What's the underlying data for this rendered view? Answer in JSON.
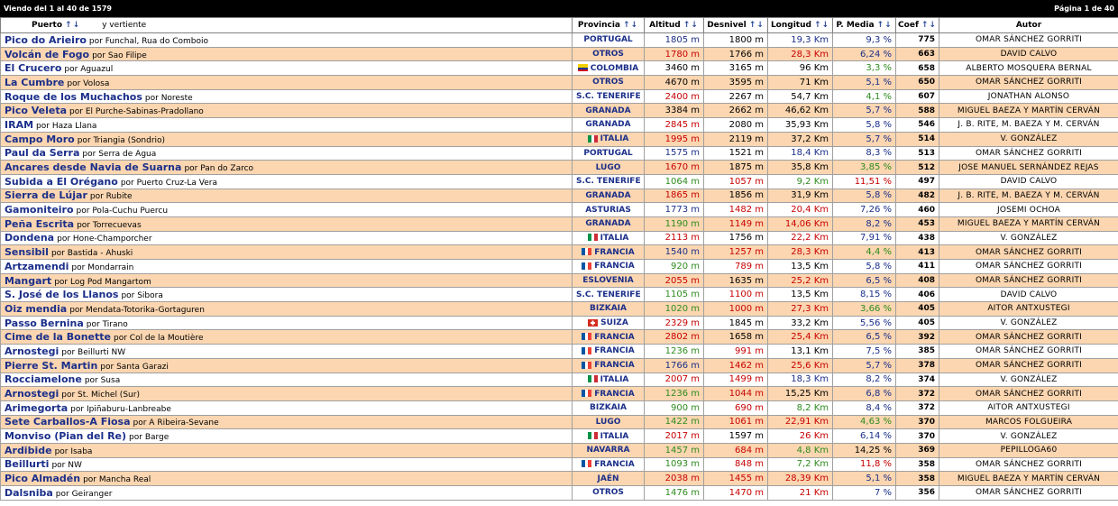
{
  "header": {
    "left": "Viendo del 1 al 40 de 1579",
    "right": "Página 1 de 40"
  },
  "columns": {
    "puerto": "Puerto",
    "vertiente": "y   vertiente",
    "provincia": "Provincia",
    "altitud": "Altitud",
    "desnivel": "Desnivel",
    "longitud": "Longitud",
    "pmedia": "P. Media",
    "coef": "Coef",
    "autor": "Autor"
  },
  "sort_arrows": "↑↓",
  "rows": [
    {
      "name": "Pico do Arieiro",
      "vert": "Funchal, Rua do Comboio",
      "prov": "PORTUGAL",
      "flag": "",
      "alt": "1805 m",
      "alt_c": "blue",
      "des": "1800 m",
      "des_c": "black",
      "lon": "19,3 Km",
      "lon_c": "blue",
      "pm": "9,3 %",
      "pm_c": "blue",
      "coef": "775",
      "autor": "OMAR SÁNCHEZ GORRITI"
    },
    {
      "name": "Volcán de Fogo",
      "vert": "Sao Filipe",
      "prov": "OTROS",
      "flag": "",
      "alt": "1780 m",
      "alt_c": "red",
      "des": "1766 m",
      "des_c": "black",
      "lon": "28,3 Km",
      "lon_c": "red",
      "pm": "6,24 %",
      "pm_c": "blue",
      "coef": "663",
      "autor": "DAVID CALVO"
    },
    {
      "name": "El Crucero",
      "vert": "Aguazul",
      "prov": "COLOMBIA",
      "flag": "colombia",
      "alt": "3460 m",
      "alt_c": "black",
      "des": "3165 m",
      "des_c": "black",
      "lon": "96 Km",
      "lon_c": "black",
      "pm": "3,3 %",
      "pm_c": "green",
      "coef": "658",
      "autor": "ALBERTO MOSQUERA BERNAL"
    },
    {
      "name": "La Cumbre",
      "vert": "Volosa",
      "prov": "OTROS",
      "flag": "",
      "alt": "4670 m",
      "alt_c": "black",
      "des": "3595 m",
      "des_c": "black",
      "lon": "71 Km",
      "lon_c": "black",
      "pm": "5,1 %",
      "pm_c": "blue",
      "coef": "650",
      "autor": "OMAR SÁNCHEZ GORRITI"
    },
    {
      "name": "Roque de los Muchachos",
      "vert": "Noreste",
      "prov": "S.C. TENERIFE",
      "flag": "",
      "alt": "2400 m",
      "alt_c": "red",
      "des": "2267 m",
      "des_c": "black",
      "lon": "54,7 Km",
      "lon_c": "black",
      "pm": "4,1 %",
      "pm_c": "green",
      "coef": "607",
      "autor": "JONATHAN ALONSO"
    },
    {
      "name": "Pico Veleta",
      "vert": "El Purche-Sabinas-Pradollano",
      "prov": "GRANADA",
      "flag": "",
      "alt": "3384 m",
      "alt_c": "black",
      "des": "2662 m",
      "des_c": "black",
      "lon": "46,62 Km",
      "lon_c": "black",
      "pm": "5,7 %",
      "pm_c": "blue",
      "coef": "588",
      "autor": "MIGUEL BAEZA Y MARTÍN CERVÁN"
    },
    {
      "name": "IRAM",
      "vert": "Haza Llana",
      "prov": "GRANADA",
      "flag": "",
      "alt": "2845 m",
      "alt_c": "red",
      "des": "2080 m",
      "des_c": "black",
      "lon": "35,93 Km",
      "lon_c": "black",
      "pm": "5,8 %",
      "pm_c": "blue",
      "coef": "546",
      "autor": "J. B. RITE, M. BAEZA Y M. CERVÁN"
    },
    {
      "name": "Campo Moro",
      "vert": "Triangia (Sondrio)",
      "prov": "ITALIA",
      "flag": "italia",
      "alt": "1995 m",
      "alt_c": "red",
      "des": "2119 m",
      "des_c": "black",
      "lon": "37,2 Km",
      "lon_c": "black",
      "pm": "5,7 %",
      "pm_c": "blue",
      "coef": "514",
      "autor": "V. GONZÁLEZ"
    },
    {
      "name": "Paul da Serra",
      "vert": "Serra de Agua",
      "prov": "PORTUGAL",
      "flag": "",
      "alt": "1575 m",
      "alt_c": "blue",
      "des": "1521 m",
      "des_c": "black",
      "lon": "18,4 Km",
      "lon_c": "blue",
      "pm": "8,3 %",
      "pm_c": "blue",
      "coef": "513",
      "autor": "OMAR SÁNCHEZ GORRITI"
    },
    {
      "name": "Ancares desde Navia de Suarna",
      "vert": "Pan do Zarco",
      "prov": "LUGO",
      "flag": "",
      "alt": "1670 m",
      "alt_c": "red",
      "des": "1875 m",
      "des_c": "black",
      "lon": "35,8 Km",
      "lon_c": "black",
      "pm": "3,85 %",
      "pm_c": "green",
      "coef": "512",
      "autor": "JOSE MANUEL SERNÁNDEZ REJAS"
    },
    {
      "name": "Subida a El Orégano",
      "vert": "Puerto Cruz-La Vera",
      "prov": "S.C. TENERIFE",
      "flag": "",
      "alt": "1064 m",
      "alt_c": "green",
      "des": "1057 m",
      "des_c": "red",
      "lon": "9,2 Km",
      "lon_c": "green",
      "pm": "11,51 %",
      "pm_c": "red",
      "coef": "497",
      "autor": "DAVID CALVO"
    },
    {
      "name": "Sierra de Lújar",
      "vert": "Rubite",
      "prov": "GRANADA",
      "flag": "",
      "alt": "1865 m",
      "alt_c": "red",
      "des": "1856 m",
      "des_c": "black",
      "lon": "31,9 Km",
      "lon_c": "black",
      "pm": "5,8 %",
      "pm_c": "blue",
      "coef": "482",
      "autor": "J. B. RITE, M. BAEZA Y M. CERVÁN"
    },
    {
      "name": "Gamoniteiro",
      "vert": "Pola-Cuchu Puercu",
      "prov": "ASTURIAS",
      "flag": "",
      "alt": "1773 m",
      "alt_c": "blue",
      "des": "1482 m",
      "des_c": "red",
      "lon": "20,4 Km",
      "lon_c": "red",
      "pm": "7,26 %",
      "pm_c": "blue",
      "coef": "460",
      "autor": "JOSEMI OCHOA"
    },
    {
      "name": "Peña Escrita",
      "vert": "Torrecuevas",
      "prov": "GRANADA",
      "flag": "",
      "alt": "1190 m",
      "alt_c": "green",
      "des": "1149 m",
      "des_c": "red",
      "lon": "14,06 Km",
      "lon_c": "red",
      "pm": "8,2 %",
      "pm_c": "blue",
      "coef": "453",
      "autor": "MIGUEL BAEZA Y MARTÍN CERVÁN"
    },
    {
      "name": "Dondena",
      "vert": "Hone-Champorcher",
      "prov": "ITALIA",
      "flag": "italia",
      "alt": "2113 m",
      "alt_c": "red",
      "des": "1756 m",
      "des_c": "black",
      "lon": "22,2 Km",
      "lon_c": "red",
      "pm": "7,91 %",
      "pm_c": "blue",
      "coef": "438",
      "autor": "V. GONZÁLEZ"
    },
    {
      "name": "Sensibil",
      "vert": "Bastida - Ahuski",
      "prov": "FRANCIA",
      "flag": "francia",
      "alt": "1540 m",
      "alt_c": "blue",
      "des": "1257 m",
      "des_c": "red",
      "lon": "28,3 Km",
      "lon_c": "red",
      "pm": "4,4 %",
      "pm_c": "green",
      "coef": "413",
      "autor": "OMAR SÁNCHEZ GORRITI"
    },
    {
      "name": "Artzamendi",
      "vert": "Mondarrain",
      "prov": "FRANCIA",
      "flag": "francia",
      "alt": "920 m",
      "alt_c": "green",
      "des": "789 m",
      "des_c": "red",
      "lon": "13,5 Km",
      "lon_c": "black",
      "pm": "5,8 %",
      "pm_c": "blue",
      "coef": "411",
      "autor": "OMAR SÁNCHEZ GORRITI"
    },
    {
      "name": "Mangart",
      "vert": "Log Pod Mangartom",
      "prov": "ESLOVENIA",
      "flag": "",
      "alt": "2055 m",
      "alt_c": "red",
      "des": "1635 m",
      "des_c": "black",
      "lon": "25,2 Km",
      "lon_c": "red",
      "pm": "6,5 %",
      "pm_c": "blue",
      "coef": "408",
      "autor": "OMAR SÁNCHEZ GORRITI"
    },
    {
      "name": "S. José de los Llanos",
      "vert": "Sibora",
      "prov": "S.C. TENERIFE",
      "flag": "",
      "alt": "1105 m",
      "alt_c": "green",
      "des": "1100 m",
      "des_c": "red",
      "lon": "13,5 Km",
      "lon_c": "black",
      "pm": "8,15 %",
      "pm_c": "blue",
      "coef": "406",
      "autor": "DAVID CALVO"
    },
    {
      "name": "Oiz mendia",
      "vert": "Mendata-Totorika-Gortaguren",
      "prov": "BIZKAIA",
      "flag": "",
      "alt": "1020 m",
      "alt_c": "green",
      "des": "1000 m",
      "des_c": "red",
      "lon": "27,3 Km",
      "lon_c": "red",
      "pm": "3,66 %",
      "pm_c": "green",
      "coef": "405",
      "autor": "AITOR ANTXUSTEGI"
    },
    {
      "name": "Passo Bernina",
      "vert": "Tirano",
      "prov": "SUIZA",
      "flag": "suiza",
      "alt": "2329 m",
      "alt_c": "red",
      "des": "1845 m",
      "des_c": "black",
      "lon": "33,2 Km",
      "lon_c": "black",
      "pm": "5,56 %",
      "pm_c": "blue",
      "coef": "405",
      "autor": "V. GONZÁLEZ"
    },
    {
      "name": "Cime de la Bonette",
      "vert": "Col de la Moutière",
      "prov": "FRANCIA",
      "flag": "francia",
      "alt": "2802 m",
      "alt_c": "red",
      "des": "1658 m",
      "des_c": "black",
      "lon": "25,4 Km",
      "lon_c": "red",
      "pm": "6,5 %",
      "pm_c": "blue",
      "coef": "392",
      "autor": "OMAR SÁNCHEZ GORRITI"
    },
    {
      "name": "Arnostegi",
      "vert": "Beillurti NW",
      "prov": "FRANCIA",
      "flag": "francia",
      "alt": "1236 m",
      "alt_c": "green",
      "des": "991 m",
      "des_c": "red",
      "lon": "13,1 Km",
      "lon_c": "black",
      "pm": "7,5 %",
      "pm_c": "blue",
      "coef": "385",
      "autor": "OMAR SÁNCHEZ GORRITI"
    },
    {
      "name": "Pierre St. Martin",
      "vert": "Santa Garazi",
      "prov": "FRANCIA",
      "flag": "francia",
      "alt": "1766 m",
      "alt_c": "blue",
      "des": "1462 m",
      "des_c": "red",
      "lon": "25,6 Km",
      "lon_c": "red",
      "pm": "5,7 %",
      "pm_c": "blue",
      "coef": "378",
      "autor": "OMAR SÁNCHEZ GORRITI"
    },
    {
      "name": "Rocciamelone",
      "vert": "Susa",
      "prov": "ITALIA",
      "flag": "italia",
      "alt": "2007 m",
      "alt_c": "red",
      "des": "1499 m",
      "des_c": "red",
      "lon": "18,3 Km",
      "lon_c": "blue",
      "pm": "8,2 %",
      "pm_c": "blue",
      "coef": "374",
      "autor": "V. GONZÁLEZ"
    },
    {
      "name": "Arnostegi",
      "vert": "St. Michel (Sur)",
      "prov": "FRANCIA",
      "flag": "francia",
      "alt": "1236 m",
      "alt_c": "green",
      "des": "1044 m",
      "des_c": "red",
      "lon": "15,25 Km",
      "lon_c": "black",
      "pm": "6,8 %",
      "pm_c": "blue",
      "coef": "372",
      "autor": "OMAR SÁNCHEZ GORRITI"
    },
    {
      "name": "Arimegorta",
      "vert": "Ipiñaburu-Lanbreabe",
      "prov": "BIZKAIA",
      "flag": "",
      "alt": "900 m",
      "alt_c": "green",
      "des": "690 m",
      "des_c": "red",
      "lon": "8,2 Km",
      "lon_c": "green",
      "pm": "8,4 %",
      "pm_c": "blue",
      "coef": "372",
      "autor": "AITOR ANTXUSTEGI"
    },
    {
      "name": "Sete Carballos-A Fiosa",
      "vert": "A Ribeira-Sevane",
      "prov": "LUGO",
      "flag": "",
      "alt": "1422 m",
      "alt_c": "green",
      "des": "1061 m",
      "des_c": "red",
      "lon": "22,91 Km",
      "lon_c": "red",
      "pm": "4,63 %",
      "pm_c": "green",
      "coef": "370",
      "autor": "MARCOS FOLGUEIRA"
    },
    {
      "name": "Monviso (Pian del Re)",
      "vert": "Barge",
      "prov": "ITALIA",
      "flag": "italia",
      "alt": "2017 m",
      "alt_c": "red",
      "des": "1597 m",
      "des_c": "black",
      "lon": "26 Km",
      "lon_c": "red",
      "pm": "6,14 %",
      "pm_c": "blue",
      "coef": "370",
      "autor": "V. GONZÁLEZ"
    },
    {
      "name": "Ardibide",
      "vert": "Isaba",
      "prov": "NAVARRA",
      "flag": "",
      "alt": "1457 m",
      "alt_c": "green",
      "des": "684 m",
      "des_c": "red",
      "lon": "4,8 Km",
      "lon_c": "green",
      "pm": "14,25 %",
      "pm_c": "black",
      "coef": "369",
      "autor": "PEPILLOGA60"
    },
    {
      "name": "Beillurti",
      "vert": "NW",
      "prov": "FRANCIA",
      "flag": "francia",
      "alt": "1093 m",
      "alt_c": "green",
      "des": "848 m",
      "des_c": "red",
      "lon": "7,2 Km",
      "lon_c": "green",
      "pm": "11,8 %",
      "pm_c": "red",
      "coef": "358",
      "autor": "OMAR SÁNCHEZ GORRITI"
    },
    {
      "name": "Pico Almadén",
      "vert": "Mancha Real",
      "prov": "JAÉN",
      "flag": "",
      "alt": "2038 m",
      "alt_c": "red",
      "des": "1455 m",
      "des_c": "red",
      "lon": "28,39 Km",
      "lon_c": "red",
      "pm": "5,1 %",
      "pm_c": "blue",
      "coef": "358",
      "autor": "MIGUEL BAEZA Y MARTÍN CERVÁN"
    },
    {
      "name": "Dalsniba",
      "vert": "Geiranger",
      "prov": "OTROS",
      "flag": "",
      "alt": "1476 m",
      "alt_c": "green",
      "des": "1470 m",
      "des_c": "red",
      "lon": "21 Km",
      "lon_c": "red",
      "pm": "7 %",
      "pm_c": "blue",
      "coef": "356",
      "autor": "OMAR SÁNCHEZ GORRITI"
    }
  ],
  "colors": {
    "green": "#2e8b1e",
    "red": "#c80000",
    "blue": "#1b2f8a",
    "row_alt": "#fbd6b0"
  }
}
